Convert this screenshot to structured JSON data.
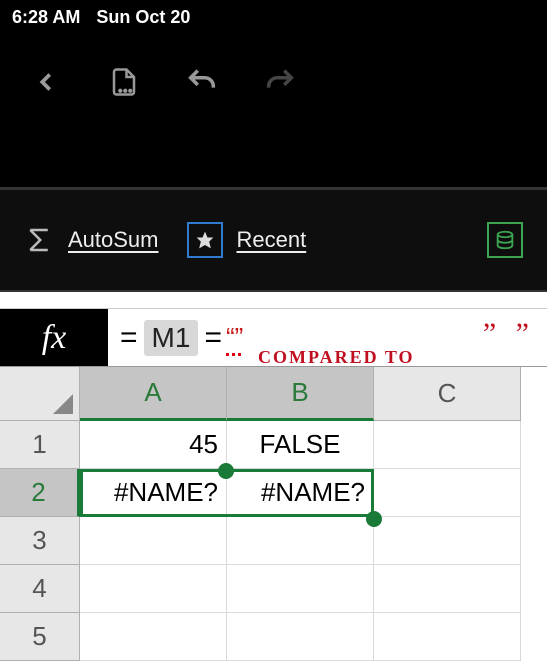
{
  "status": {
    "time": "6:28 AM",
    "date": "Sun Oct 20"
  },
  "ribbon": {
    "autosum": "AutoSum",
    "recent": "Recent"
  },
  "formula": {
    "fx": "fx",
    "eq": "=",
    "ref": "M1",
    "eq2": "=",
    "curly": "“”",
    "annotation": "COMPARED TO",
    "quotes": "”  ”"
  },
  "columns": [
    "A",
    "B",
    "C"
  ],
  "rows": [
    "1",
    "2",
    "3",
    "4",
    "5"
  ],
  "cells": {
    "A1": "45",
    "B1": "FALSE",
    "A2": "#NAME?",
    "B2": "#NAME?"
  },
  "selection": {
    "col_start": 0,
    "col_end": 1,
    "row": 1
  }
}
